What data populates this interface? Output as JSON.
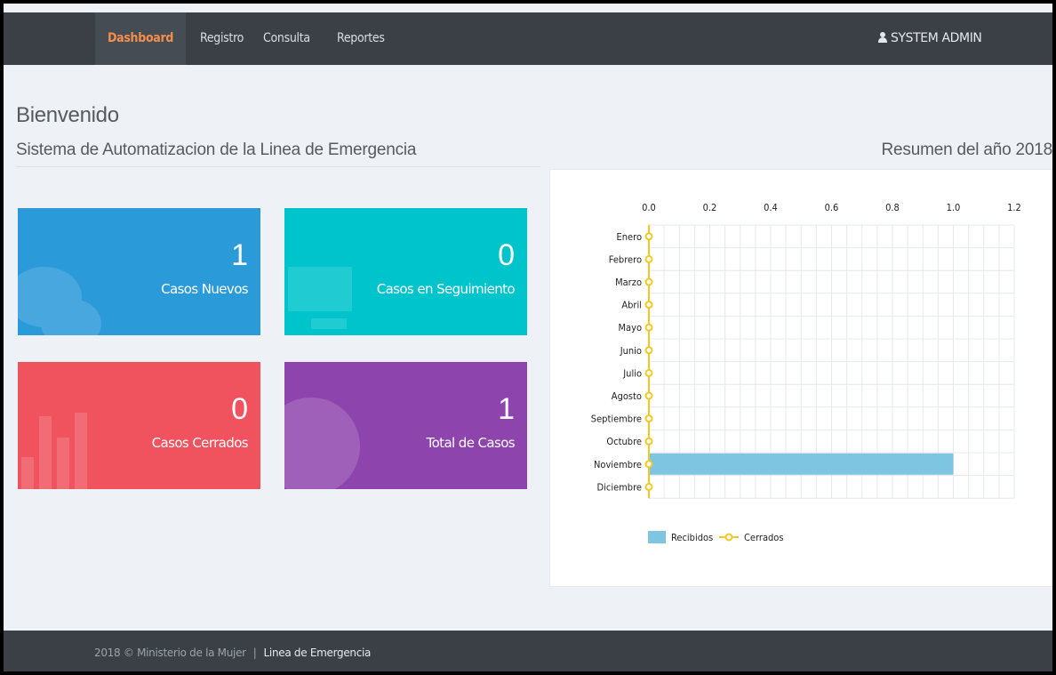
{
  "nav": {
    "items": [
      {
        "label": "Dashboard",
        "active": true
      },
      {
        "label": "Registro",
        "active": false
      },
      {
        "label": "Consulta",
        "active": false
      },
      {
        "label": "Reportes",
        "active": false
      }
    ],
    "user_label": "SYSTEM ADMIN",
    "user_icon": "user-icon"
  },
  "header": {
    "title": "Bienvenido",
    "subtitle": "Sistema de Automatizacion de la Linea de Emergencia",
    "summary": "Resumen del año 2018"
  },
  "tiles": [
    {
      "value": "1",
      "label": "Casos Nuevos",
      "color": "#2b9ad9",
      "icon": "chat-bubble-icon"
    },
    {
      "value": "0",
      "label": "Casos en Seguimiento",
      "color": "#00c4cc",
      "icon": "monitor-icon"
    },
    {
      "value": "0",
      "label": "Casos Cerrados",
      "color": "#f0525e",
      "icon": "bar-chart-icon"
    },
    {
      "value": "1",
      "label": "Total de Casos",
      "color": "#8e44ad",
      "icon": "globe-icon"
    }
  ],
  "chart_data": {
    "type": "bar",
    "orientation": "horizontal",
    "categories": [
      "Enero",
      "Febrero",
      "Marzo",
      "Abril",
      "Mayo",
      "Junio",
      "Julio",
      "Agosto",
      "Septiembre",
      "Octubre",
      "Noviembre",
      "Diciembre"
    ],
    "series": [
      {
        "name": "Recibidos",
        "type": "bar",
        "color": "#7ec5e2",
        "values": [
          0,
          0,
          0,
          0,
          0,
          0,
          0,
          0,
          0,
          0,
          1,
          0
        ]
      },
      {
        "name": "Cerrados",
        "type": "line",
        "color": "#f2c824",
        "values": [
          0,
          0,
          0,
          0,
          0,
          0,
          0,
          0,
          0,
          0,
          0,
          0
        ]
      }
    ],
    "xlim": [
      0,
      1.2
    ],
    "xticks": [
      "0.0",
      "0.2",
      "0.4",
      "0.6",
      "0.8",
      "1.0",
      "1.2"
    ],
    "grid": true,
    "legend": "bottom"
  },
  "footer": {
    "copyright": "2018 © Ministerio de la Mujer",
    "separator": "|",
    "link": "Linea de Emergencia"
  }
}
